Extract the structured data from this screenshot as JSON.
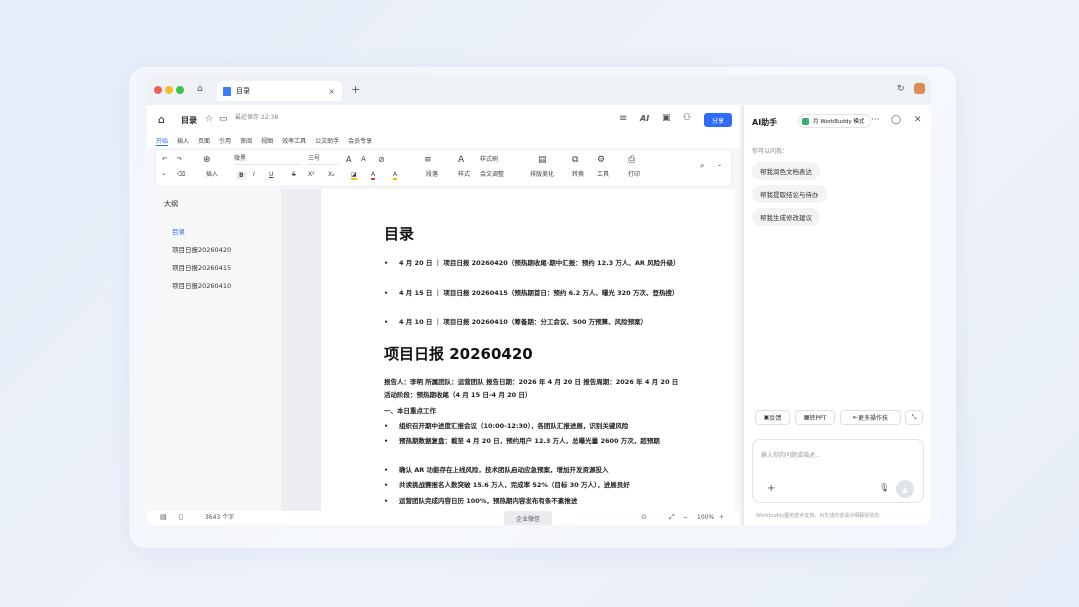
{
  "browser": {
    "tab_title": "目录",
    "tab_close": "×",
    "new_tab": "+"
  },
  "doc": {
    "title": "目录",
    "saved_status": "最近保存 22:38",
    "share_label": "分享",
    "ai_label": "AI"
  },
  "menu": [
    "开始",
    "插入",
    "页面",
    "引用",
    "审阅",
    "视图",
    "效率工具",
    "公文助手",
    "会员专享"
  ],
  "toolbar": {
    "insert": "插入",
    "font_name": "微黑",
    "font_size": "三号",
    "style_label": "样式",
    "text_style": "样式",
    "format_brush": "样式刷",
    "merge_label": "会文调整",
    "layout_beautify": "排版美化",
    "paragraph": "段落",
    "convert": "转换",
    "tools": "工具",
    "print": "打印"
  },
  "outline": {
    "heading": "大纲",
    "items": [
      "目录",
      "项目日报20260420",
      "项目日报20260415",
      "项目日报20260410"
    ]
  },
  "page": {
    "toc_title": "目录",
    "toc_items": [
      "4 月 20 日 ｜ 项目日报 20260420（预热期收尾·期中汇报：预约 12.3 万人、AR 风险升级）",
      "4 月 15 日 ｜ 项目日报 20260415（预热期首日：预约 6.2 万人、曝光 320 万次、登热搜）",
      "4 月 10 日 ｜ 项目日报 20260410（筹备期：分工会议、500 万预算、风险预案）"
    ],
    "report_title": "项目日报 20260420",
    "report_meta": "报告人：李明 所属团队：运营团队 报告日期：2026 年 4 月 20 日 报告周期：2026 年 4 月 20 日 活动阶段：预热期收尾（4 月 15 日-4 月 20 日）",
    "section_heading": "一、本日重点工作",
    "bullets": [
      "组织召开期中进度汇报会议（10:00-12:30），各团队汇报进展，识别关键风险",
      "预热期数据复盘：截至 4 月 20 日，预约用户 12.3 万人，总曝光量 2600 万次，超预期",
      "确认 AR 功能存在上线风险，技术团队启动应急预案，增加开发资源投入",
      "共读挑战赛报名人数突破 15.6 万人，完成率 52%（目标 30 万人），进展良好",
      "运营团队完成内容日历 100%，预热期内容发布有条不紊推进"
    ]
  },
  "status": {
    "word_count": "3643 个字",
    "center_label": "企业微信",
    "zoom": "100%"
  },
  "ai_panel": {
    "title": "AI助手",
    "model": "月  WorkBuddy 模式",
    "hint": "你可以问我：",
    "suggestions": [
      "帮我润色文档表达",
      "帮我提取结论与待办",
      "帮我生成修改建议"
    ],
    "actions": [
      "反馈",
      "转PPT",
      "更多操作技"
    ],
    "placeholder": "输入你的问题或描述...",
    "disclaimer": "Workbuddy服务技术支持，AI生成内容请仔细甄别信息"
  },
  "colors": {
    "accent": "#2f6df6",
    "mac_red": "#f25f58",
    "mac_yellow": "#f9bd2e",
    "mac_green": "#39c747"
  }
}
